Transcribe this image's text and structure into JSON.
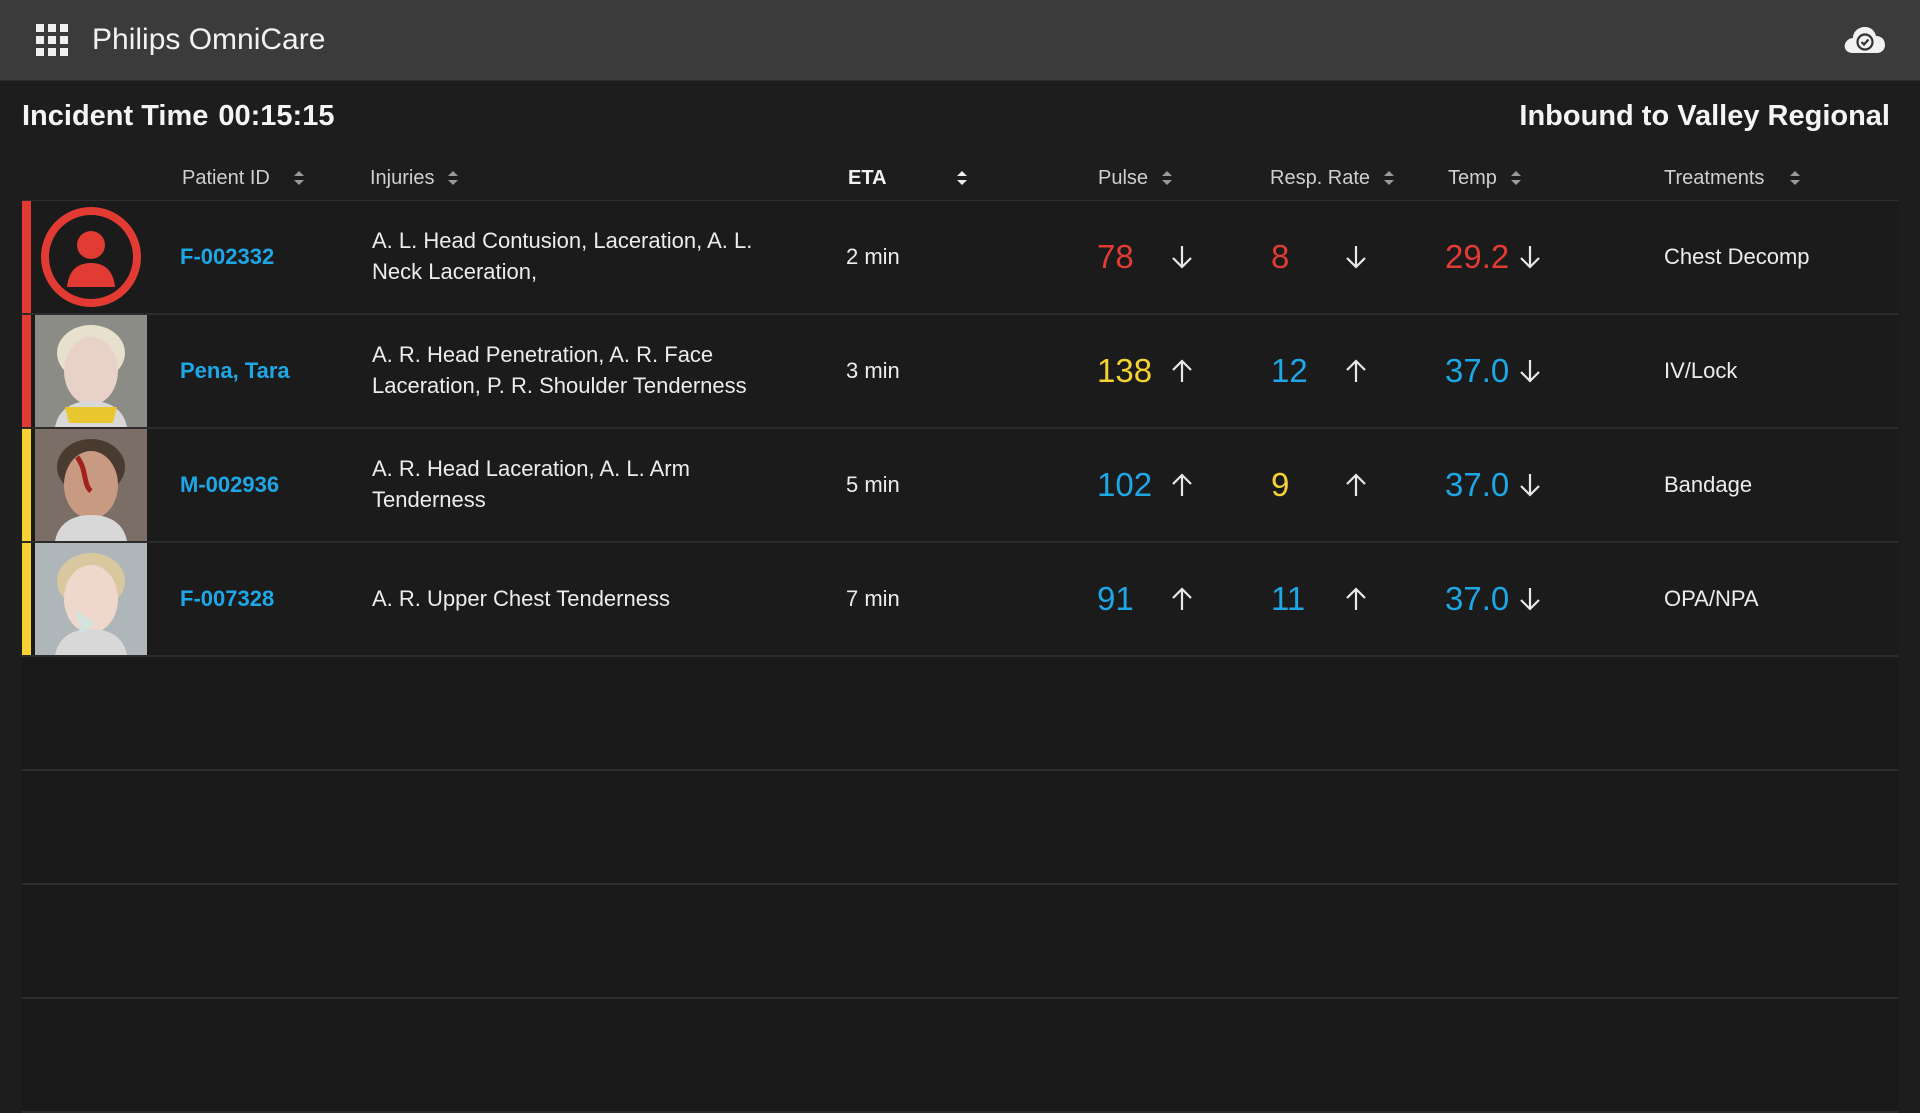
{
  "app": {
    "title": "Philips OmniCare"
  },
  "incident": {
    "label": "Incident Time",
    "time": "00:15:15"
  },
  "destination": "Inbound to Valley Regional",
  "columns": {
    "patient_id": "Patient ID",
    "injuries": "Injuries",
    "eta": "ETA",
    "pulse": "Pulse",
    "resp": "Resp. Rate",
    "temp": "Temp",
    "treatments": "Treatments"
  },
  "colors": {
    "red": "#e23b33",
    "yellow": "#f5d232",
    "blue": "#1ea7e6",
    "link": "#1ea7e6"
  },
  "rows": [
    {
      "severity": "red",
      "photo": "avatar-placeholder",
      "id": "F-002332",
      "injuries": "A. L. Head Contusion, Laceration, A. L. Neck Laceration,",
      "eta": "2 min",
      "pulse": "78",
      "pulse_trend": "down",
      "pulse_color": "red",
      "resp": "8",
      "resp_trend": "down",
      "resp_color": "red",
      "temp": "29.2",
      "temp_trend": "down",
      "temp_color": "red",
      "treatment": "Chest Decomp"
    },
    {
      "severity": "red",
      "photo": "patient-photo",
      "id": "Pena, Tara",
      "injuries": "A. R. Head Penetration, A. R. Face Laceration, P. R. Shoulder Tenderness",
      "eta": "3 min",
      "pulse": "138",
      "pulse_trend": "up",
      "pulse_color": "yellow",
      "resp": "12",
      "resp_trend": "up",
      "resp_color": "blue",
      "temp": "37.0",
      "temp_trend": "down",
      "temp_color": "blue",
      "treatment": "IV/Lock"
    },
    {
      "severity": "yellow",
      "photo": "patient-photo",
      "id": "M-002936",
      "injuries": "A. R. Head Laceration, A. L. Arm Tenderness",
      "eta": "5 min",
      "pulse": "102",
      "pulse_trend": "up",
      "pulse_color": "blue",
      "resp": "9",
      "resp_trend": "up",
      "resp_color": "yellow",
      "temp": "37.0",
      "temp_trend": "down",
      "temp_color": "blue",
      "treatment": "Bandage"
    },
    {
      "severity": "yellow",
      "photo": "patient-photo",
      "id": "F-007328",
      "injuries": "A. R. Upper Chest Tenderness",
      "eta": "7 min",
      "pulse": "91",
      "pulse_trend": "up",
      "pulse_color": "blue",
      "resp": "11",
      "resp_trend": "up",
      "resp_color": "blue",
      "temp": "37.0",
      "temp_trend": "down",
      "temp_color": "blue",
      "treatment": "OPA/NPA"
    }
  ],
  "empty_rows": 4
}
